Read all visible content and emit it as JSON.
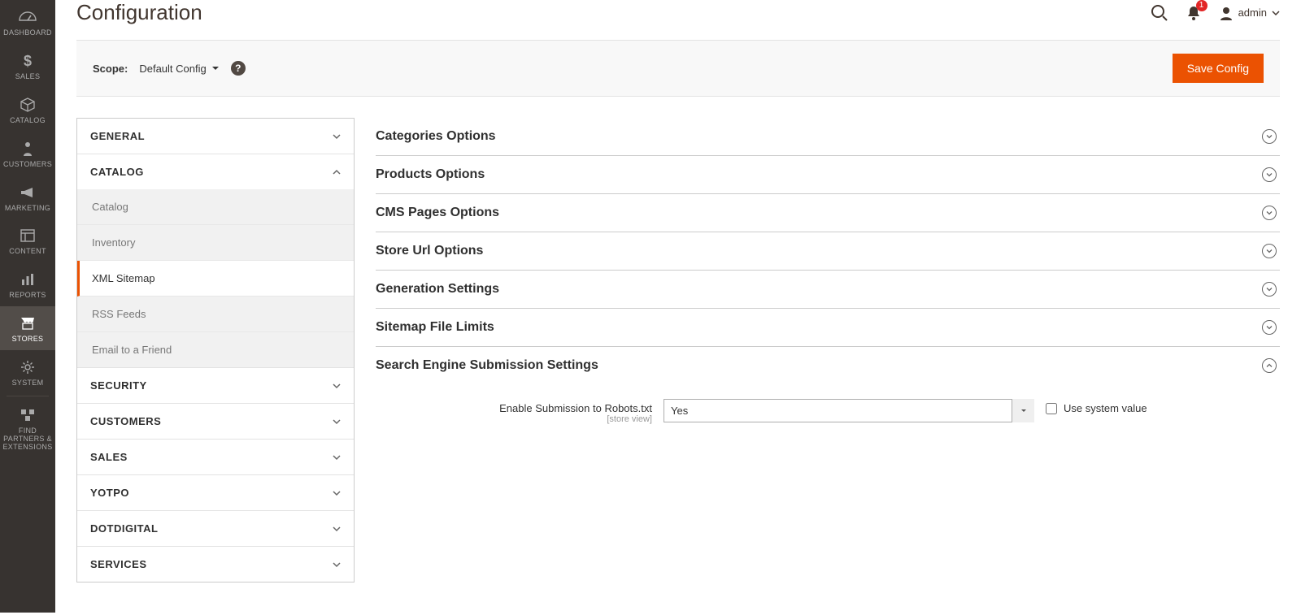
{
  "leftnav": {
    "items": [
      {
        "label": "DASHBOARD",
        "icon": "dashboard-icon"
      },
      {
        "label": "SALES",
        "icon": "dollar-icon"
      },
      {
        "label": "CATALOG",
        "icon": "box-icon"
      },
      {
        "label": "CUSTOMERS",
        "icon": "person-icon"
      },
      {
        "label": "MARKETING",
        "icon": "megaphone-icon"
      },
      {
        "label": "CONTENT",
        "icon": "layout-icon"
      },
      {
        "label": "REPORTS",
        "icon": "bars-icon"
      },
      {
        "label": "STORES",
        "icon": "store-icon"
      },
      {
        "label": "SYSTEM",
        "icon": "gear-icon"
      },
      {
        "label": "FIND PARTNERS & EXTENSIONS",
        "icon": "blocks-icon"
      }
    ],
    "active_index": 7
  },
  "header": {
    "page_title": "Configuration",
    "notifications_count": "1",
    "admin_label": "admin"
  },
  "scopebar": {
    "label": "Scope:",
    "value": "Default Config",
    "save_label": "Save Config"
  },
  "config_nav": {
    "groups": [
      {
        "label": "GENERAL",
        "expanded": false
      },
      {
        "label": "CATALOG",
        "expanded": true,
        "items": [
          "Catalog",
          "Inventory",
          "XML Sitemap",
          "RSS Feeds",
          "Email to a Friend"
        ],
        "active_item_index": 2
      },
      {
        "label": "SECURITY",
        "expanded": false
      },
      {
        "label": "CUSTOMERS",
        "expanded": false
      },
      {
        "label": "SALES",
        "expanded": false
      },
      {
        "label": "YOTPO",
        "expanded": false
      },
      {
        "label": "DOTDIGITAL",
        "expanded": false
      },
      {
        "label": "SERVICES",
        "expanded": false
      }
    ]
  },
  "sections": [
    {
      "title": "Categories Options",
      "expanded": false
    },
    {
      "title": "Products Options",
      "expanded": false
    },
    {
      "title": "CMS Pages Options",
      "expanded": false
    },
    {
      "title": "Store Url Options",
      "expanded": false
    },
    {
      "title": "Generation Settings",
      "expanded": false
    },
    {
      "title": "Sitemap File Limits",
      "expanded": false
    },
    {
      "title": "Search Engine Submission Settings",
      "expanded": true
    }
  ],
  "robots_field": {
    "label": "Enable Submission to Robots.txt",
    "scope": "[store view]",
    "value": "Yes",
    "use_system_label": "Use system value",
    "use_system_checked": false
  }
}
